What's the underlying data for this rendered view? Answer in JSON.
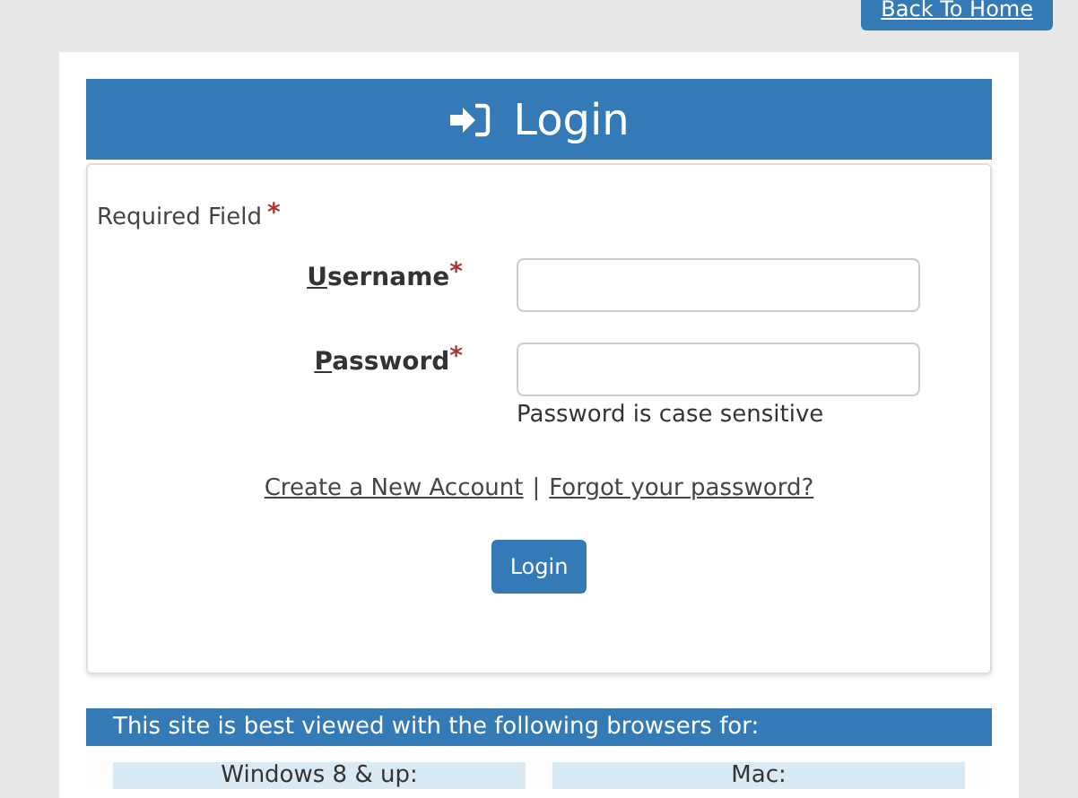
{
  "top_button": "Back To Home",
  "header": {
    "title": "Login"
  },
  "form": {
    "required_note": "Required Field",
    "required_mark": "*",
    "fields": [
      {
        "label": "Username",
        "required": true
      },
      {
        "label": "Password",
        "required": true,
        "hint": "Password is case sensitive"
      }
    ],
    "links": [
      "Create a New Account",
      "Forgot your password?"
    ],
    "separator": "|",
    "submit": "Login"
  },
  "browsers": {
    "title": "This site is best viewed with the following browsers for:",
    "columns": [
      "Windows 8 & up:",
      "Mac:"
    ]
  }
}
